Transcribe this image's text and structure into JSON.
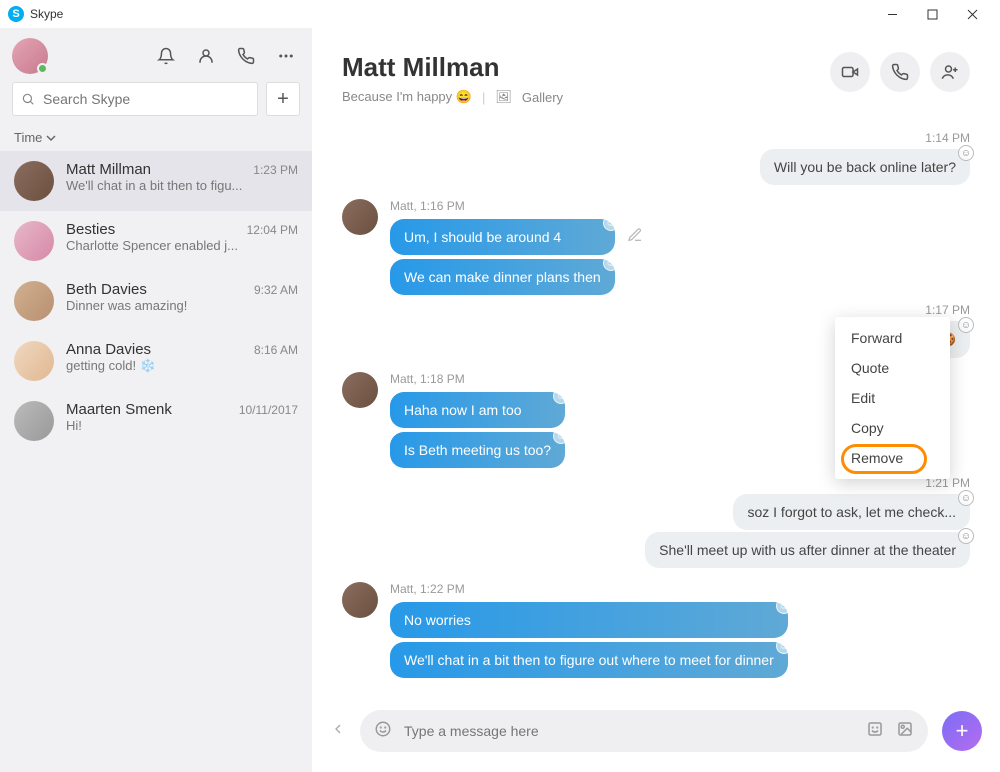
{
  "app": {
    "title": "Skype"
  },
  "search": {
    "placeholder": "Search Skype"
  },
  "sort": {
    "label": "Time"
  },
  "chats": [
    {
      "name": "Matt Millman",
      "time": "1:23 PM",
      "preview": "We'll chat in a bit then to figu..."
    },
    {
      "name": "Besties",
      "time": "12:04 PM",
      "preview": "Charlotte Spencer enabled j..."
    },
    {
      "name": "Beth Davies",
      "time": "9:32 AM",
      "preview": "Dinner was amazing!"
    },
    {
      "name": "Anna Davies",
      "time": "8:16 AM",
      "preview": "getting cold! ❄️"
    },
    {
      "name": "Maarten Smenk",
      "time": "10/11/2017",
      "preview": "Hi!"
    }
  ],
  "header": {
    "name": "Matt Millman",
    "status": "Because I'm happy 😄",
    "gallery": "Gallery"
  },
  "msgs": {
    "t1": "1:14 PM",
    "o1": "Will you be back online later?",
    "s1": "Matt, 1:16 PM",
    "i1": "Um, I should be around 4",
    "i2": "We can make dinner plans then",
    "t2": "1:17 PM",
    "o2": "already 🍪",
    "s2": "Matt, 1:18 PM",
    "i3": "Haha now I am too",
    "i4": "Is Beth meeting us too?",
    "t3": "1:21 PM",
    "o3": "soz I forgot to ask, let me check...",
    "o4": "She'll meet up with us after dinner at the theater",
    "s3": "Matt, 1:22 PM",
    "i5": "No worries",
    "i6": "We'll chat in a bit then to figure out where to meet for dinner"
  },
  "menu": {
    "forward": "Forward",
    "quote": "Quote",
    "edit": "Edit",
    "copy": "Copy",
    "remove": "Remove"
  },
  "composer": {
    "placeholder": "Type a message here"
  }
}
